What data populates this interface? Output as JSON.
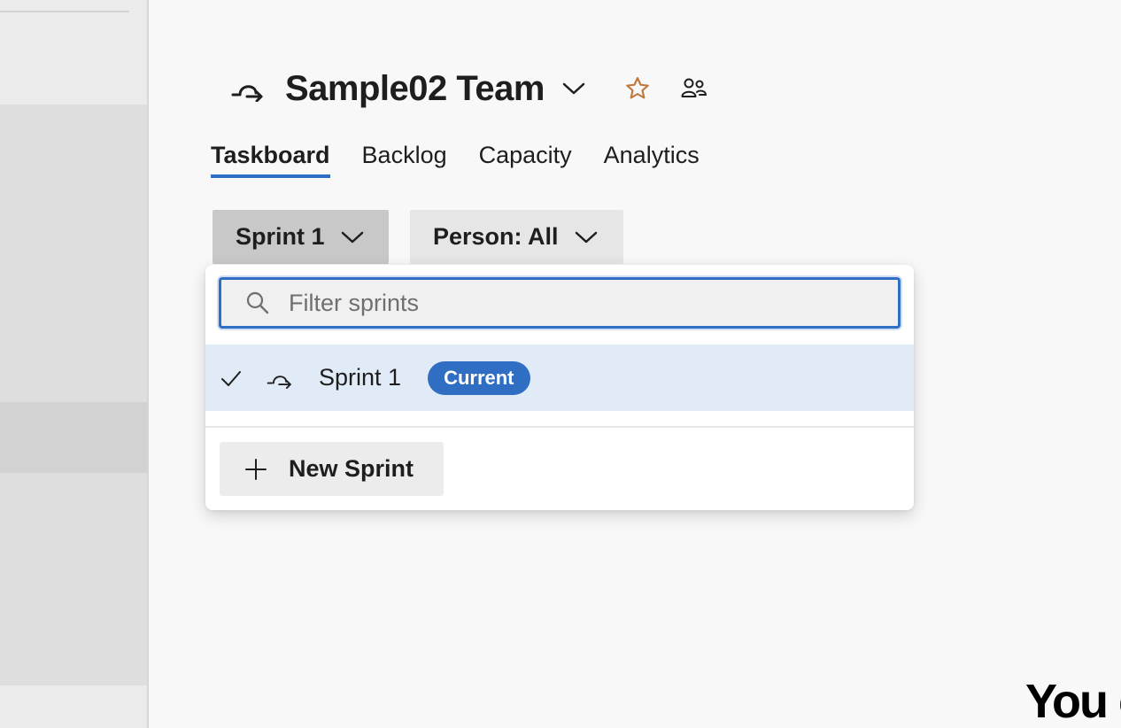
{
  "header": {
    "team_name": "Sample02 Team",
    "team_icon": "iteration-icon",
    "favorite_icon": "star-icon",
    "members_icon": "people-icon"
  },
  "tabs": [
    {
      "label": "Taskboard",
      "active": true
    },
    {
      "label": "Backlog",
      "active": false
    },
    {
      "label": "Capacity",
      "active": false
    },
    {
      "label": "Analytics",
      "active": false
    }
  ],
  "filters": {
    "sprint_label": "Sprint 1",
    "person_label": "Person: All"
  },
  "dropdown": {
    "filter_placeholder": "Filter sprints",
    "filter_value": "",
    "items": [
      {
        "name": "Sprint 1",
        "badge": "Current",
        "selected": true
      }
    ],
    "new_sprint_label": "New Sprint"
  },
  "footer_text": "You c",
  "colors": {
    "accent": "#2f6ec2",
    "selected_row": "#e0ebf7",
    "star": "#c0773a"
  }
}
